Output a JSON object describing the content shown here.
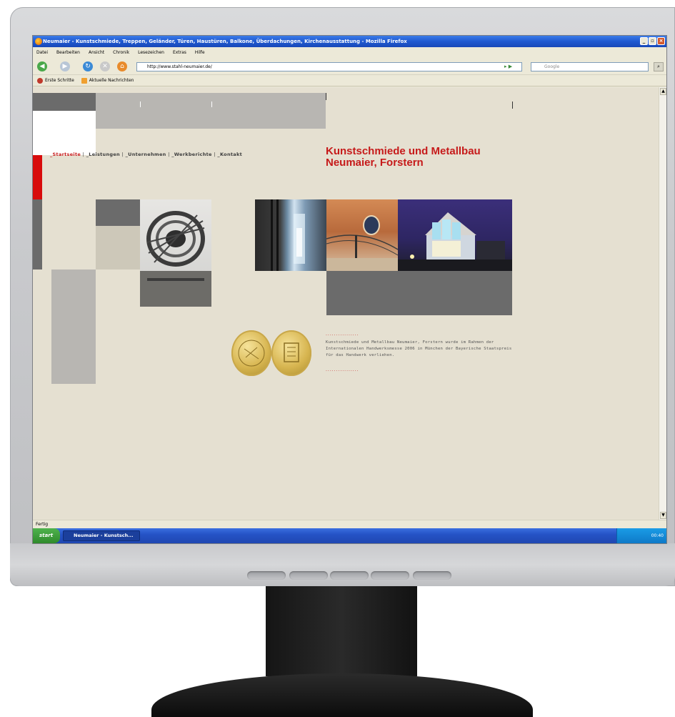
{
  "window": {
    "title": "Neumaier - Kunstschmiede, Treppen, Geländer, Türen, Haustüren, Balkone, Überdachungen, Kirchenausstattung - Mozilla Firefox"
  },
  "menu": [
    "Datei",
    "Bearbeiten",
    "Ansicht",
    "Chronik",
    "Lesezeichen",
    "Extras",
    "Hilfe"
  ],
  "browser": {
    "url": "http://www.stahl-neumaier.de/",
    "search_placeholder": "Google",
    "bookmarks": [
      "Erste Schritte",
      "Aktuelle Nachrichten"
    ]
  },
  "site": {
    "nav": [
      "_Startseite",
      "_Leistungen",
      "_Unternehmen",
      "_Werkberichte",
      "_Kontakt"
    ],
    "nav_sep": "|",
    "headline": "Kunstschmiede und Metallbau Neumaier, Forstern",
    "dots": "................",
    "info": "Kunstschmiede und Metallbau Neumaier, Forstern wurde im Rahmen der Internationalen Handwerksmesse 2006 in München der Bayerische Staatspreis für das Handwerk verliehen."
  },
  "status": {
    "text": "Fertig"
  },
  "taskbar": {
    "start": "start",
    "task": "Neumaier - Kunstsch...",
    "clock": "00:40"
  },
  "colors": {
    "accent": "#c61a1a",
    "page_bg": "#e5e0d1",
    "titlebar": "#1f59d0"
  }
}
